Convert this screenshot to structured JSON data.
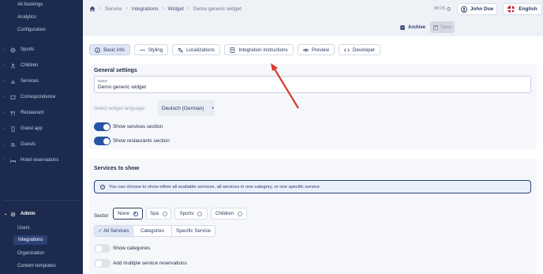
{
  "sidebar": {
    "top_subitems": [
      "All bookings",
      "Analytics",
      "Configuration"
    ],
    "items": [
      {
        "label": "Sports",
        "icon": "sports-icon"
      },
      {
        "label": "Children",
        "icon": "children-icon"
      },
      {
        "label": "Services",
        "icon": "services-icon"
      },
      {
        "label": "Correspondence",
        "icon": "correspondence-icon"
      },
      {
        "label": "Restaurant",
        "icon": "restaurant-icon"
      },
      {
        "label": "Guest app",
        "icon": "phone-icon"
      },
      {
        "label": "Guests",
        "icon": "guests-icon"
      },
      {
        "label": "Hotel reservations",
        "icon": "bed-icon"
      }
    ],
    "admin": {
      "label": "Admin",
      "icon": "gear-icon"
    },
    "admin_subitems": [
      "Users",
      "Integrations",
      "Organization",
      "Content templates"
    ]
  },
  "breadcrumb": [
    "Service",
    "Integrations",
    "Widget",
    "Demo generic widget"
  ],
  "header": {
    "time": "09:15",
    "user": "John Doe",
    "language": "English",
    "archive_label": "Archive",
    "save_label": "Save"
  },
  "tabs": [
    "Basic info",
    "Styling",
    "Localizations",
    "Integration instructions",
    "Preview",
    "Developer"
  ],
  "general": {
    "title": "General settings",
    "name_label": "Name",
    "name_value": "Demo generic widget",
    "language_label": "Select widget language:",
    "language_value": "Deutsch (German)",
    "toggle_services": "Show services section",
    "toggle_restaurants": "Show restaurants section"
  },
  "services": {
    "title": "Services to show",
    "info": "You can choose to show either all available services, all services in one category, or one specific service",
    "sector_label": "Sector",
    "sectors": [
      "None",
      "Spa",
      "Sports",
      "Children"
    ],
    "selected_sector": "None",
    "scope": [
      "✓ All Services",
      "Categories",
      "Specific Service"
    ],
    "toggle_categories": "Show categories",
    "toggle_multiple": "Add multiple service reservations"
  },
  "colors": {
    "sidebar_bg": "#1b2a4e",
    "accent": "#2653a3",
    "annotation_arrow": "#d83a2a"
  }
}
